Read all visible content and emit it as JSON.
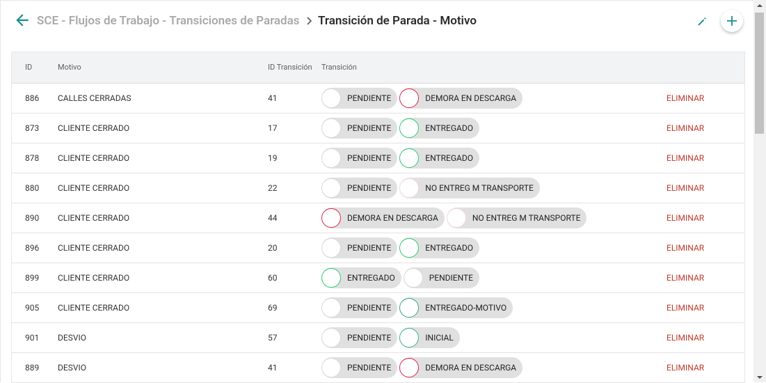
{
  "header": {
    "parent": "SCE - Flujos de Trabajo - Transiciones de Paradas",
    "current": "Transición de Parada - Motivo"
  },
  "table": {
    "columns": [
      "ID",
      "Motivo",
      "ID Transición",
      "Transición"
    ],
    "delete_label": "ELIMINAR",
    "rows": [
      {
        "id": "886",
        "motivo": "CALLES CERRADAS",
        "idt": "41",
        "from": {
          "label": "PENDIENTE",
          "color": "#d9d9d9"
        },
        "to": {
          "label": "DEMORA EN DESCARGA",
          "color": "#e0254a"
        }
      },
      {
        "id": "873",
        "motivo": "CLIENTE CERRADO",
        "idt": "17",
        "from": {
          "label": "PENDIENTE",
          "color": "#d9d9d9"
        },
        "to": {
          "label": "ENTREGADO",
          "color": "#2ecc71"
        }
      },
      {
        "id": "878",
        "motivo": "CLIENTE CERRADO",
        "idt": "19",
        "from": {
          "label": "PENDIENTE",
          "color": "#d9d9d9"
        },
        "to": {
          "label": "ENTREGADO",
          "color": "#2ecc71"
        }
      },
      {
        "id": "880",
        "motivo": "CLIENTE CERRADO",
        "idt": "22",
        "from": {
          "label": "PENDIENTE",
          "color": "#d9d9d9"
        },
        "to": {
          "label": "NO ENTREG M TRANSPORTE",
          "color": "#f5d7dc"
        }
      },
      {
        "id": "890",
        "motivo": "CLIENTE CERRADO",
        "idt": "44",
        "from": {
          "label": "DEMORA EN DESCARGA",
          "color": "#e0254a"
        },
        "to": {
          "label": "NO ENTREG M TRANSPORTE",
          "color": "#f5d7dc"
        }
      },
      {
        "id": "896",
        "motivo": "CLIENTE CERRADO",
        "idt": "20",
        "from": {
          "label": "PENDIENTE",
          "color": "#d9d9d9"
        },
        "to": {
          "label": "ENTREGADO",
          "color": "#2ecc71"
        }
      },
      {
        "id": "899",
        "motivo": "CLIENTE CERRADO",
        "idt": "60",
        "from": {
          "label": "ENTREGADO",
          "color": "#2ecc71"
        },
        "to": {
          "label": "PENDIENTE",
          "color": "#d9d9d9"
        }
      },
      {
        "id": "905",
        "motivo": "CLIENTE CERRADO",
        "idt": "69",
        "from": {
          "label": "PENDIENTE",
          "color": "#d9d9d9"
        },
        "to": {
          "label": "ENTREGADO-MOTIVO",
          "color": "#3aa58a"
        }
      },
      {
        "id": "901",
        "motivo": "DESVIO",
        "idt": "57",
        "from": {
          "label": "PENDIENTE",
          "color": "#d9d9d9"
        },
        "to": {
          "label": "INICIAL",
          "color": "#33b888"
        }
      },
      {
        "id": "889",
        "motivo": "DESVIO",
        "idt": "41",
        "from": {
          "label": "PENDIENTE",
          "color": "#d9d9d9"
        },
        "to": {
          "label": "DEMORA EN DESCARGA",
          "color": "#e0254a"
        }
      }
    ]
  },
  "colors": {
    "accent": "#1a8c8c",
    "delete": "#c0392b"
  },
  "icons": {
    "back": "arrow-left-icon",
    "separator": "chevron-right-icon",
    "edit": "pencil-icon",
    "add": "plus-icon"
  }
}
